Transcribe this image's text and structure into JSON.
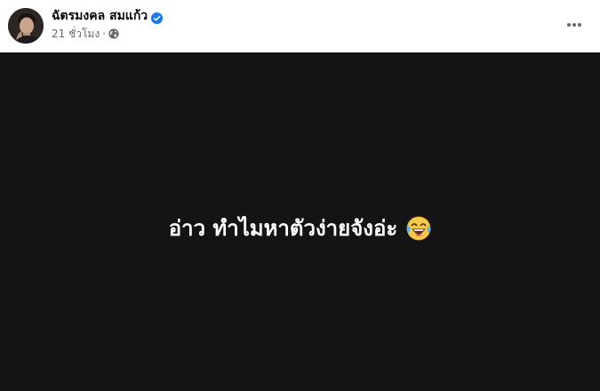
{
  "post": {
    "author": {
      "name": "ฉัตรมงคล สมแก้ว",
      "verified": true,
      "avatar_icon": "avatar-photo"
    },
    "meta": {
      "time": "21 ชั่วโมง",
      "separator": "·",
      "privacy_icon": "globe-icon"
    },
    "status_text": "อ่าว ทำไมหาตัวง่ายจังอ่ะ",
    "emoji_icon": "face-with-tears-of-joy-icon"
  },
  "colors": {
    "background_post": "#141414",
    "verified_blue": "#1877f2",
    "meta_gray": "#65676b",
    "emoji_yellow": "#f7c948"
  }
}
